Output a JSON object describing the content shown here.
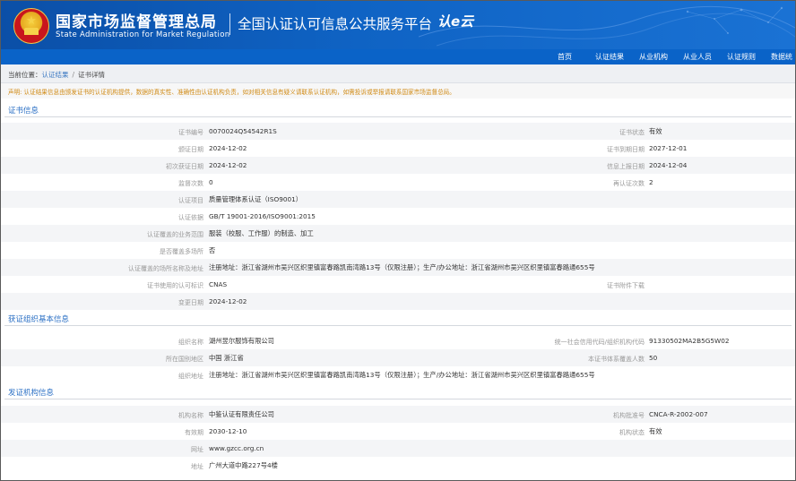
{
  "header": {
    "org_cn": "国家市场监督管理总局",
    "org_en": "State Administration  for  Market Regulation",
    "platform_title": "全国认证认可信息公共服务平台",
    "logo_text": "认e云",
    "brand_color": "#0b4fa7"
  },
  "nav": {
    "items": [
      "首页",
      "认证结果",
      "从业机构",
      "从业人员",
      "认证规则",
      "数据统"
    ]
  },
  "breadcrumb": {
    "prefix": "当前位置：",
    "link": "认证结果",
    "sep": "/",
    "current": "证书详情"
  },
  "notice": "声明: 认证结果信息由颁发证书的认证机构提供，数据的真实性、准确性由认证机构负责，如对相关信息有疑义请联系认证机构，如需投诉或举报请联系国家市场监督总局。",
  "cert": {
    "section_title": "证书信息",
    "cert_no_label": "证书编号",
    "cert_no": "0070024Q54542R1S",
    "status_label": "证书状态",
    "status": "有效",
    "issue_date_label": "颁证日期",
    "issue_date": "2024-12-02",
    "expiry_label": "证书到期日期",
    "expiry": "2027-12-01",
    "first_date_label": "初次获证日期",
    "first_date": "2024-12-02",
    "report_date_label": "信息上报日期",
    "report_date": "2024-12-04",
    "surv_label": "监督次数",
    "surv": "0",
    "recert_label": "再认证次数",
    "recert": "2",
    "project_label": "认证项目",
    "project": "质量管理体系认证（ISO9001）",
    "basis_label": "认证依据",
    "basis": "GB/T 19001-2016/ISO9001:2015",
    "scope_label": "认证覆盖的业务范围",
    "scope": "服装（校服、工作服）的制造、加工",
    "multisite_label": "是否覆盖多场所",
    "multisite": "否",
    "sites_label": "认证覆盖的场所名称及地址",
    "sites": "注册地址：浙江省湖州市吴兴区织里镇富春路凯南湾路13号（仅限注册）；生产/办公地址：浙江省湖州市吴兴区织里镇富春路通655号",
    "mark_label": "证书使用的认可标识",
    "mark": "CNAS",
    "attach_label": "证书附件下载",
    "change_date_label": "变更日期",
    "change_date": "2024-12-02"
  },
  "org": {
    "section_title": "获证组织基本信息",
    "name_label": "组织名称",
    "name": "湖州昱尔服饰有限公司",
    "credit_label": "统一社会信用代码/组织机构代码",
    "credit": "91330502MA2B5G5W02",
    "region_label": "所在国别地区",
    "region": "中国 浙江省",
    "staff_label": "本证书体系覆盖人数",
    "staff": "50",
    "addr_label": "组织地址",
    "addr": "注册地址：浙江省湖州市吴兴区织里镇富春路凯南湾路13号（仅限注册）；生产/办公地址：浙江省湖州市吴兴区织里镇富春路通655号"
  },
  "issuer": {
    "section_title": "发证机构信息",
    "name_label": "机构名称",
    "name": "中鉴认证有限责任公司",
    "approval_label": "机构批准号",
    "approval": "CNCA-R-2002-007",
    "valid_label": "有效期",
    "valid": "2030-12-10",
    "state_label": "机构状态",
    "state": "有效",
    "web_label": "网址",
    "web": "www.gzcc.org.cn",
    "addr_label": "地址",
    "addr": "广州大道中路227号4楼"
  }
}
